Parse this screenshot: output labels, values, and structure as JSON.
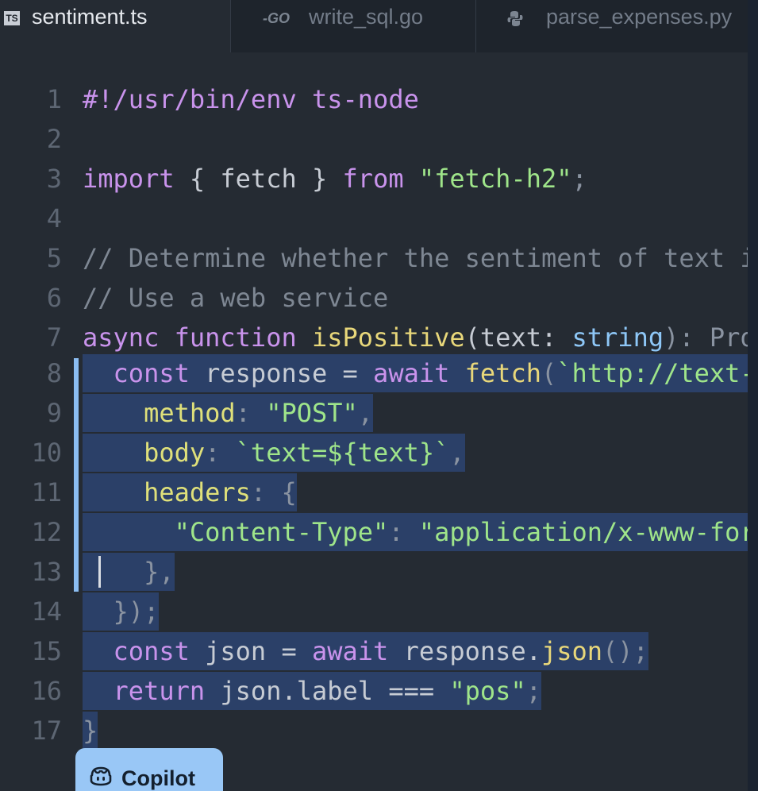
{
  "tabs": [
    {
      "label": "sentiment.ts",
      "icon": "typescript-file-icon",
      "badge": "TS",
      "active": true
    },
    {
      "label": "write_sql.go",
      "icon": "go-file-icon",
      "badge": "GO",
      "active": false
    },
    {
      "label": "parse_expenses.py",
      "icon": "python-file-icon",
      "active": false
    }
  ],
  "lines": [
    {
      "n": "1"
    },
    {
      "n": "2"
    },
    {
      "n": "3"
    },
    {
      "n": "4"
    },
    {
      "n": "5"
    },
    {
      "n": "6"
    },
    {
      "n": "7"
    },
    {
      "n": "8"
    },
    {
      "n": "9"
    },
    {
      "n": "10"
    },
    {
      "n": "11"
    },
    {
      "n": "12"
    },
    {
      "n": "13"
    },
    {
      "n": "14"
    },
    {
      "n": "15"
    },
    {
      "n": "16"
    },
    {
      "n": "17"
    }
  ],
  "code": {
    "l1": "#!/usr/bin/env ts-node",
    "l3": {
      "a": "import",
      "b": " { fetch } ",
      "c": "from",
      "d": " ",
      "e": "\"fetch-h2\"",
      "f": ";"
    },
    "l5": "// Determine whether the sentiment of text is positive",
    "l6": "// Use a web service",
    "l7": {
      "a": "async",
      "b": " ",
      "c": "function",
      "d": " ",
      "e": "isPositive",
      "f": "(text: ",
      "g": "string",
      "h": "): Promise<boolean> {"
    },
    "l8": {
      "a": "  const",
      "b": " response = ",
      "c": "await",
      "d": " ",
      "e": "fetch",
      "f": "(",
      "g": "`http://text-processing.com/api/sentiment/`",
      "h": ", {"
    },
    "l9": {
      "a": "    ",
      "b": "method",
      "c": ": ",
      "d": "\"POST\"",
      "e": ","
    },
    "l10": {
      "a": "    ",
      "b": "body",
      "c": ": ",
      "d": "`text=${text}`",
      "e": ","
    },
    "l11": {
      "a": "    ",
      "b": "headers",
      "c": ": {"
    },
    "l12": {
      "a": "      ",
      "b": "\"Content-Type\"",
      "c": ": ",
      "d": "\"application/x-www-form-urlencoded\"",
      "e": ","
    },
    "l13": "    },",
    "l14": "  });",
    "l15": {
      "a": "  const",
      "b": " json = ",
      "c": "await",
      "d": " response.",
      "e": "json",
      "f": "();"
    },
    "l16": {
      "a": "  return",
      "b": " json.label === ",
      "c": "\"pos\"",
      "d": ";"
    },
    "l17": "}"
  },
  "copilot": {
    "label": "Copilot",
    "icon": "copilot-icon"
  },
  "colors": {
    "background": "#252b33",
    "selection": "#2b4068",
    "accent": "#99c7f6"
  }
}
